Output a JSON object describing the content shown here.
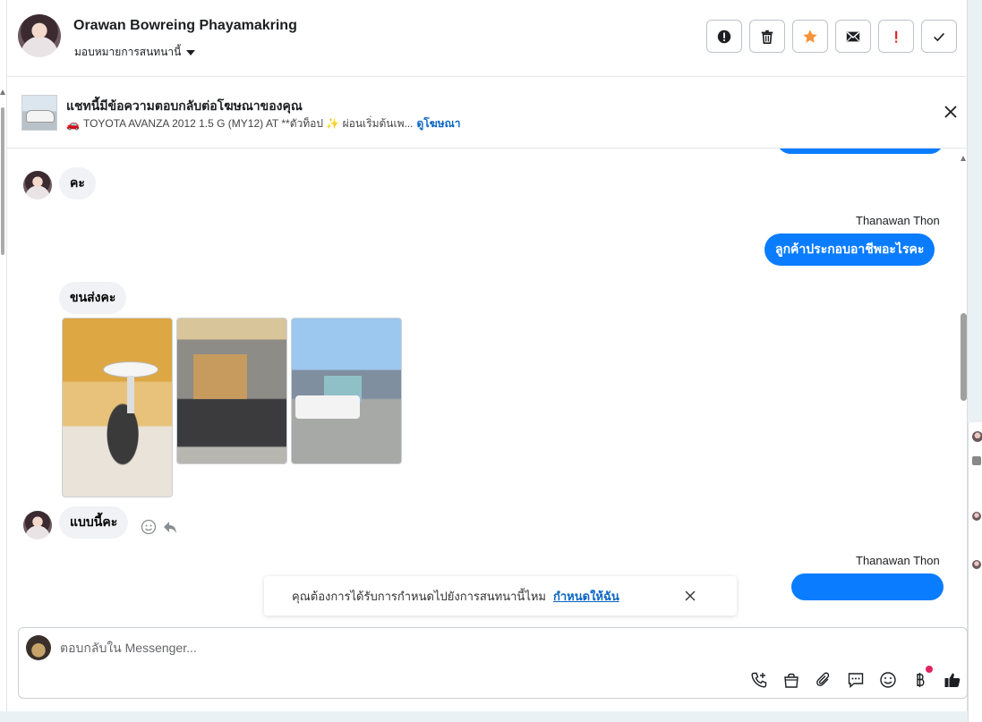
{
  "header": {
    "contact_name": "Orawan Bowreing Phayamakring",
    "assign_label": "มอบหมายการสนทนานี้",
    "actions": [
      {
        "name": "report-button",
        "icon": "alert-circle-icon"
      },
      {
        "name": "delete-button",
        "icon": "trash-icon"
      },
      {
        "name": "star-button",
        "icon": "star-icon"
      },
      {
        "name": "mark-unread-button",
        "icon": "envelope-icon"
      },
      {
        "name": "spam-button",
        "icon": "exclamation-icon"
      },
      {
        "name": "done-button",
        "icon": "check-icon"
      }
    ]
  },
  "ad": {
    "title": "แชทนี้มีข้อความตอบกลับต่อโฆษณาของคุณ",
    "car_emoji": "🚗",
    "subtitle": "TOYOTA AVANZA 2012 1.5 G (MY12) AT **ตัวท็อป ✨ ผ่อนเริ่มต้นเพ...",
    "link": "ดูโฆษณา"
  },
  "messages": {
    "m1": "คะ",
    "sender_1": "Thanawan Thon",
    "m2": "ลูกค้าประกอบอาชีพอะไรคะ",
    "m3": "ขนส่งคะ",
    "m4": "แบบนี้คะ",
    "sender_2": "Thanawan Thon"
  },
  "toast": {
    "text": "คุณต้องการได้รับการกำหนดไปยังการสนทนานี้ไหม",
    "link": "กำหนดให้ฉัน"
  },
  "composer": {
    "placeholder": "ตอบกลับใน Messenger...",
    "tools": [
      "phone-add-icon",
      "shopping-bag-icon",
      "paperclip-icon",
      "saved-reply-icon",
      "emoji-icon",
      "baht-icon",
      "thumbs-up-icon"
    ]
  },
  "colors": {
    "accent": "#0a7cff",
    "link": "#0a66c2",
    "star": "#f7923a",
    "alert": "#e02020"
  }
}
